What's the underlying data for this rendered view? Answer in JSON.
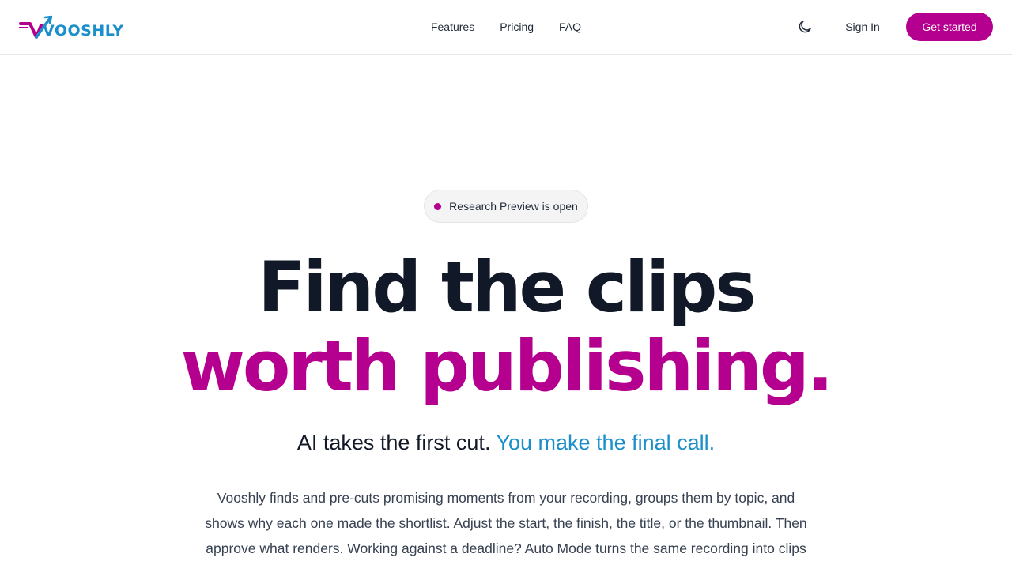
{
  "brand": {
    "name": "VOOSHLY",
    "primary_color": "#b5008f",
    "accent_color": "#1b8fc9",
    "text_color": "#111827"
  },
  "nav": {
    "links": [
      "Features",
      "Pricing",
      "FAQ"
    ],
    "theme_toggle_icon": "moon-icon",
    "sign_in_label": "Sign In",
    "cta_label": "Get started"
  },
  "hero": {
    "badge_text": "Research Preview is open",
    "title_line1": "Find the clips",
    "title_line2": "worth publishing.",
    "tagline_part1": "AI takes the first cut.",
    "tagline_part2": "You make the final call.",
    "description": "Vooshly finds and pre-cuts promising moments from your recording, groups them by topic, and shows why each one made the shortlist. Adjust the start, the finish, the title, or the thumbnail. Then approve what renders. Working against a deadline? Auto Mode turns the same recording into clips"
  }
}
